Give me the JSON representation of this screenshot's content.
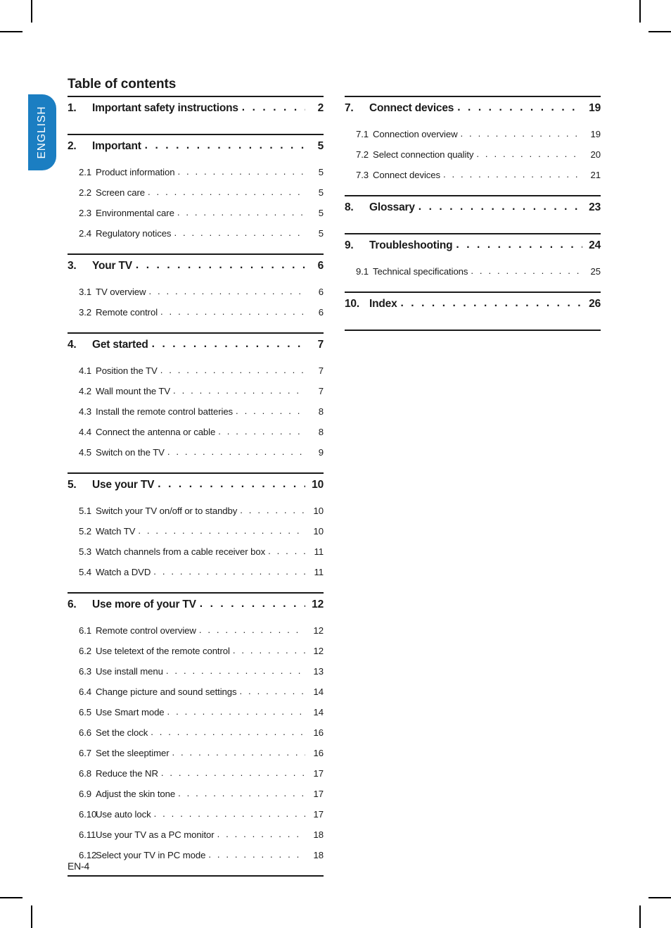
{
  "page": {
    "title": "Table of contents",
    "footer": "EN-4",
    "language_tab": "ENGLISH",
    "accent_color": "#1b7ec2",
    "text_color": "#1a1a1a",
    "leader_dots": ". . . . . . . . . . . . . . . . . . . . . . . . . . . . . . . . . . . . . . . . . . . . . . . . . . . . . . . . . . . . . . . ."
  },
  "left_column": [
    {
      "num": "1.",
      "label": "Important safety instructions",
      "page": "2",
      "children": []
    },
    {
      "num": "2.",
      "label": "Important",
      "page": "5",
      "children": [
        {
          "num": "2.1",
          "label": "Product information",
          "page": "5"
        },
        {
          "num": "2.2",
          "label": "Screen care",
          "page": "5"
        },
        {
          "num": "2.3",
          "label": "Environmental care",
          "page": "5"
        },
        {
          "num": "2.4",
          "label": "Regulatory notices",
          "page": "5"
        }
      ]
    },
    {
      "num": "3.",
      "label": "Your TV",
      "page": "6",
      "children": [
        {
          "num": "3.1",
          "label": "TV overview",
          "page": "6"
        },
        {
          "num": "3.2",
          "label": "Remote control",
          "page": "6"
        }
      ]
    },
    {
      "num": "4.",
      "label": "Get started",
      "page": "7",
      "children": [
        {
          "num": "4.1",
          "label": "Position the TV",
          "page": "7"
        },
        {
          "num": "4.2",
          "label": "Wall mount the TV",
          "page": "7"
        },
        {
          "num": "4.3",
          "label": "Install the remote control batteries",
          "page": "8"
        },
        {
          "num": "4.4",
          "label": "Connect the antenna or cable",
          "page": "8"
        },
        {
          "num": "4.5",
          "label": "Switch on the TV",
          "page": "9"
        }
      ]
    },
    {
      "num": "5.",
      "label": "Use your TV",
      "page": "10",
      "children": [
        {
          "num": "5.1",
          "label": "Switch your TV on/off or to standby",
          "page": "10"
        },
        {
          "num": "5.2",
          "label": "Watch TV",
          "page": "10"
        },
        {
          "num": "5.3",
          "label": "Watch channels from a cable receiver box",
          "page": "11"
        },
        {
          "num": "5.4",
          "label": "Watch a DVD",
          "page": "11"
        }
      ]
    },
    {
      "num": "6.",
      "label": "Use more of your TV",
      "page": "12",
      "children": [
        {
          "num": "6.1",
          "label": "Remote control overview",
          "page": "12"
        },
        {
          "num": "6.2",
          "label": "Use teletext of the remote control",
          "page": "12"
        },
        {
          "num": "6.3",
          "label": "Use install menu",
          "page": "13"
        },
        {
          "num": "6.4",
          "label": "Change picture and sound settings",
          "page": "14"
        },
        {
          "num": "6.5",
          "label": "Use Smart mode",
          "page": "14"
        },
        {
          "num": "6.6",
          "label": "Set the clock",
          "page": "16"
        },
        {
          "num": "6.7",
          "label": "Set the sleeptimer",
          "page": "16"
        },
        {
          "num": "6.8",
          "label": "Reduce the NR",
          "page": "17"
        },
        {
          "num": "6.9",
          "label": "Adjust the skin tone",
          "page": "17"
        },
        {
          "num": "6.10",
          "label": "Use auto lock",
          "page": "17"
        },
        {
          "num": "6.11",
          "label": "Use your TV as a PC monitor",
          "page": "18"
        },
        {
          "num": "6.12",
          "label": "Select your TV in PC mode",
          "page": "18"
        }
      ]
    }
  ],
  "right_column": [
    {
      "num": "7.",
      "label": "Connect devices",
      "page": "19",
      "children": [
        {
          "num": "7.1",
          "label": "Connection overview",
          "page": "19"
        },
        {
          "num": "7.2",
          "label": "Select connection quality",
          "page": "20"
        },
        {
          "num": "7.3",
          "label": "Connect devices",
          "page": "21"
        }
      ]
    },
    {
      "num": "8.",
      "label": "Glossary",
      "page": "23",
      "children": []
    },
    {
      "num": "9.",
      "label": "Troubleshooting",
      "page": "24",
      "children": [
        {
          "num": "9.1",
          "label": "Technical specifications",
          "page": "25"
        }
      ]
    },
    {
      "num": "10.",
      "label": "Index",
      "page": "26",
      "children": []
    }
  ]
}
